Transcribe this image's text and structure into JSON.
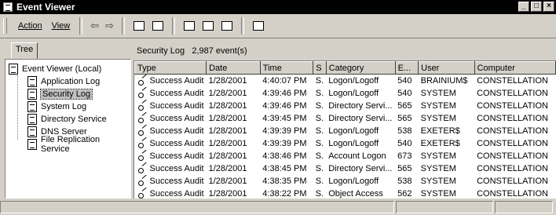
{
  "window": {
    "title": "Event Viewer"
  },
  "menu": {
    "action": "Action",
    "view": "View"
  },
  "tree": {
    "tab": "Tree",
    "root": "Event Viewer (Local)",
    "items": [
      "Application Log",
      "Security Log",
      "System Log",
      "Directory Service",
      "DNS Server",
      "File Replication Service"
    ],
    "selected": "Security Log"
  },
  "list": {
    "header_name": "Security Log",
    "header_count": "2,987 event(s)",
    "columns": [
      "Type",
      "Date",
      "Time",
      "S",
      "Category",
      "E...",
      "User",
      "Computer"
    ],
    "rows": [
      [
        "Success Audit",
        "1/28/2001",
        "4:40:07 PM",
        "S.",
        "Logon/Logoff",
        "540",
        "BRAINIUM$",
        "CONSTELLATION"
      ],
      [
        "Success Audit",
        "1/28/2001",
        "4:39:46 PM",
        "S.",
        "Logon/Logoff",
        "540",
        "SYSTEM",
        "CONSTELLATION"
      ],
      [
        "Success Audit",
        "1/28/2001",
        "4:39:46 PM",
        "S.",
        "Directory Servi...",
        "565",
        "SYSTEM",
        "CONSTELLATION"
      ],
      [
        "Success Audit",
        "1/28/2001",
        "4:39:45 PM",
        "S.",
        "Directory Servi...",
        "565",
        "SYSTEM",
        "CONSTELLATION"
      ],
      [
        "Success Audit",
        "1/28/2001",
        "4:39:39 PM",
        "S.",
        "Logon/Logoff",
        "538",
        "EXETER$",
        "CONSTELLATION"
      ],
      [
        "Success Audit",
        "1/28/2001",
        "4:39:39 PM",
        "S.",
        "Logon/Logoff",
        "540",
        "EXETER$",
        "CONSTELLATION"
      ],
      [
        "Success Audit",
        "1/28/2001",
        "4:38:46 PM",
        "S.",
        "Account Logon",
        "673",
        "SYSTEM",
        "CONSTELLATION"
      ],
      [
        "Success Audit",
        "1/28/2001",
        "4:38:45 PM",
        "S.",
        "Directory Servi...",
        "565",
        "SYSTEM",
        "CONSTELLATION"
      ],
      [
        "Success Audit",
        "1/28/2001",
        "4:38:35 PM",
        "S.",
        "Logon/Logoff",
        "538",
        "SYSTEM",
        "CONSTELLATION"
      ],
      [
        "Success Audit",
        "1/28/2001",
        "4:38:22 PM",
        "S.",
        "Object Access",
        "562",
        "SYSTEM",
        "CONSTELLATION"
      ]
    ]
  }
}
